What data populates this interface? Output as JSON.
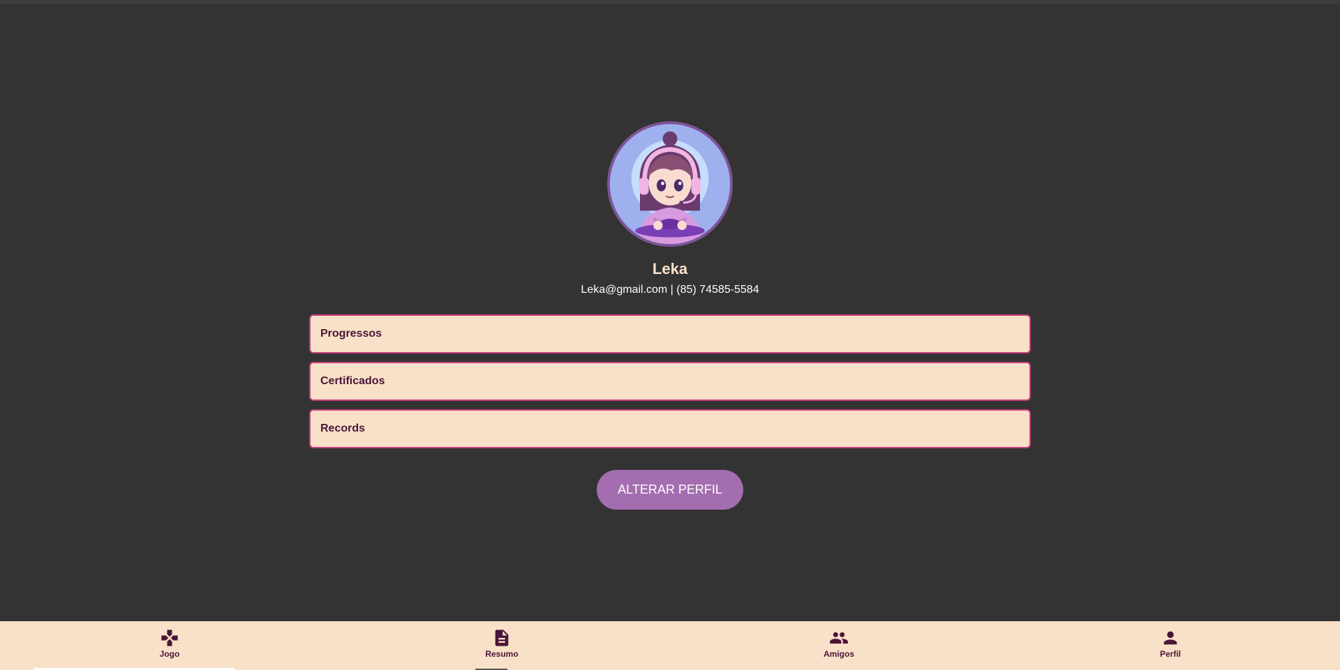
{
  "colors": {
    "background": "#333333",
    "card": "#f9e0c8",
    "card_border": "#c9417f",
    "text_dark": "#4a1538",
    "name_text": "#fbe2c9",
    "button": "#a46db0"
  },
  "profile": {
    "name": "Leka",
    "contact": "Leka@gmail.com | (85) 74585-5584"
  },
  "menu": {
    "items": [
      {
        "label": "Progressos"
      },
      {
        "label": "Certificados"
      },
      {
        "label": "Records"
      }
    ]
  },
  "actions": {
    "edit_profile_label": "ALTERAR PERFIL"
  },
  "bottom_nav": {
    "items": [
      {
        "label": "Jogo",
        "icon": "gamepad-icon"
      },
      {
        "label": "Resumo",
        "icon": "document-icon"
      },
      {
        "label": "Amigos",
        "icon": "group-icon"
      },
      {
        "label": "Perfil",
        "icon": "person-icon"
      }
    ]
  }
}
